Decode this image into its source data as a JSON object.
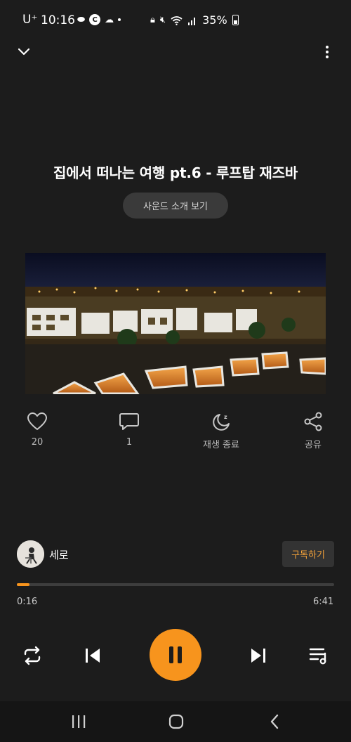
{
  "status_bar": {
    "carrier": "U⁺",
    "time": "10:16",
    "battery": "35%"
  },
  "header": {
    "collapse_icon": "chevron-down-icon",
    "more_icon": "more-vertical-icon"
  },
  "track": {
    "title": "집에서 떠나는 여행 pt.6 - 루프탑 재즈바",
    "intro_button": "사운드 소개 보기"
  },
  "actions": [
    {
      "icon": "heart-icon",
      "label": "20"
    },
    {
      "icon": "comment-icon",
      "label": "1"
    },
    {
      "icon": "sleep-timer-icon",
      "label": "재생 종료"
    },
    {
      "icon": "share-icon",
      "label": "공유"
    }
  ],
  "creator": {
    "name": "세로",
    "subscribe": "구독하기"
  },
  "progress": {
    "current": "0:16",
    "total": "6:41",
    "fraction": 0.04
  },
  "colors": {
    "accent": "#f7941d",
    "background": "#1c1c1c"
  }
}
